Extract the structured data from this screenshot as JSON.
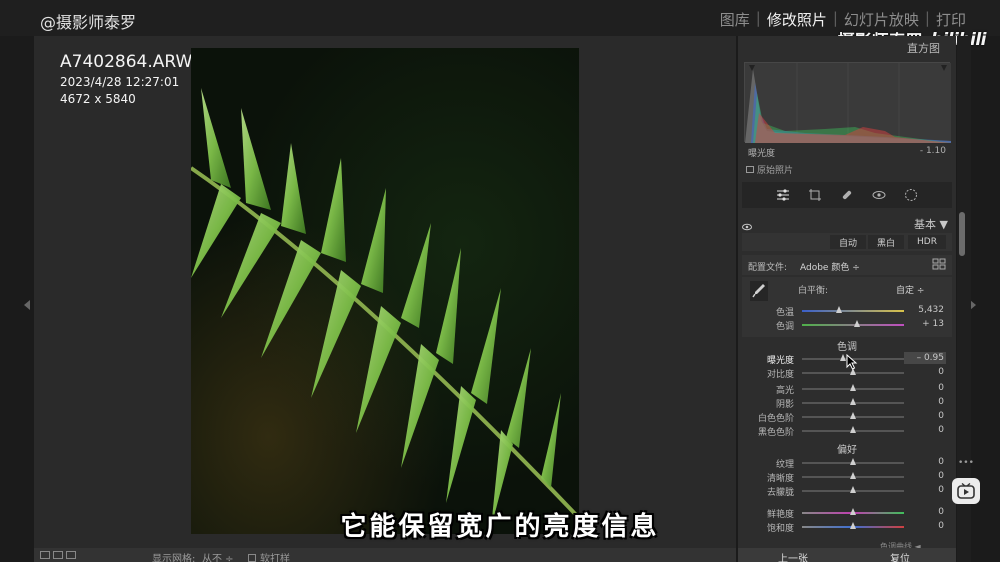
{
  "watermark": {
    "top_left": "@摄影师泰罗",
    "channel_name": "摄影师泰罗",
    "brand": "bilibili"
  },
  "modules": [
    {
      "label": "图库",
      "active": false
    },
    {
      "label": "修改照片",
      "active": true
    },
    {
      "label": "幻灯片放映",
      "active": false
    },
    {
      "label": "打印",
      "active": false
    }
  ],
  "photo_info": {
    "file_name": "A7402864.ARW",
    "date": "2023/4/28 12:27:01",
    "dimensions": "4672 x 5840"
  },
  "subtitle": "它能保留宽广的亮度信息",
  "toolbar": {
    "grid_label": "显示网格:",
    "grid_value": "从不 ÷",
    "soft_proof": "软打样"
  },
  "histogram": {
    "title": "直方图",
    "readout_label": "曝光度",
    "readout_value": "- 1.10",
    "original_photo": "原始照片"
  },
  "basic": {
    "title": "基本 ▼",
    "treatment_buttons": [
      "自动",
      "黑白",
      "HDR"
    ],
    "profile_label": "配置文件:",
    "profile_value": "Adobe 颜色 ÷",
    "wb_label": "白平衡:",
    "wb_value": "自定 ÷",
    "wb_sliders": [
      {
        "label": "色温",
        "value": "5,432",
        "position": 0.36
      },
      {
        "label": "色调",
        "value": "+ 13",
        "position": 0.54
      }
    ],
    "tone_title": "色调",
    "tone_sliders": [
      {
        "label": "曝光度",
        "value": "– 0.95",
        "position": 0.4,
        "active": true
      },
      {
        "label": "对比度",
        "value": "0",
        "position": 0.5
      },
      {
        "label": "高光",
        "value": "0",
        "position": 0.5
      },
      {
        "label": "阴影",
        "value": "0",
        "position": 0.5
      },
      {
        "label": "白色色阶",
        "value": "0",
        "position": 0.5
      },
      {
        "label": "黑色色阶",
        "value": "0",
        "position": 0.5
      }
    ],
    "presence_title": "偏好",
    "presence_sliders": [
      {
        "label": "纹理",
        "value": "0",
        "position": 0.5
      },
      {
        "label": "清晰度",
        "value": "0",
        "position": 0.5
      },
      {
        "label": "去朦胧",
        "value": "0",
        "position": 0.5
      },
      {
        "label": "鲜艳度",
        "value": "0",
        "position": 0.5
      },
      {
        "label": "饱和度",
        "value": "0",
        "position": 0.5
      }
    ]
  },
  "footer": {
    "prev": "上一张",
    "reset": "复位",
    "tone_curve_peek": "色调曲线 ◄"
  },
  "colors": {
    "panel_bg": "#2d2d2d",
    "workspace_bg": "#2a2a2a",
    "active_text": "#f2f2f2"
  }
}
